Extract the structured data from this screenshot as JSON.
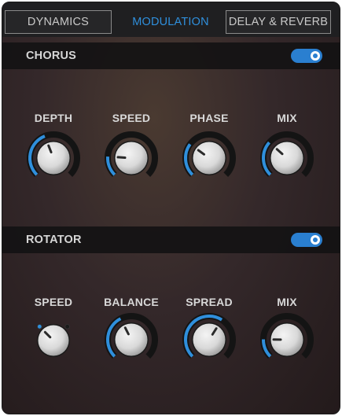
{
  "tabs": [
    {
      "label": "DYNAMICS",
      "state": "inactive"
    },
    {
      "label": "MODULATION",
      "state": "active"
    },
    {
      "label": "DELAY & REVERB",
      "state": "inactive"
    }
  ],
  "chorus": {
    "title": "CHORUS",
    "enabled": true,
    "knobs": [
      {
        "label": "DEPTH",
        "value": 0.42
      },
      {
        "label": "SPEED",
        "value": 0.18
      },
      {
        "label": "PHASE",
        "value": 0.3
      },
      {
        "label": "MIX",
        "value": 0.32
      }
    ]
  },
  "rotator": {
    "title": "ROTATOR",
    "enabled": true,
    "knobs": [
      {
        "label": "SPEED",
        "value": 0.0,
        "kind": "switch"
      },
      {
        "label": "BALANCE",
        "value": 0.4
      },
      {
        "label": "SPREAD",
        "value": 0.62
      },
      {
        "label": "MIX",
        "value": 0.17
      }
    ]
  },
  "colors": {
    "accent": "#2f8fdc",
    "track": "#141414",
    "cap": "#d9d9d9"
  }
}
